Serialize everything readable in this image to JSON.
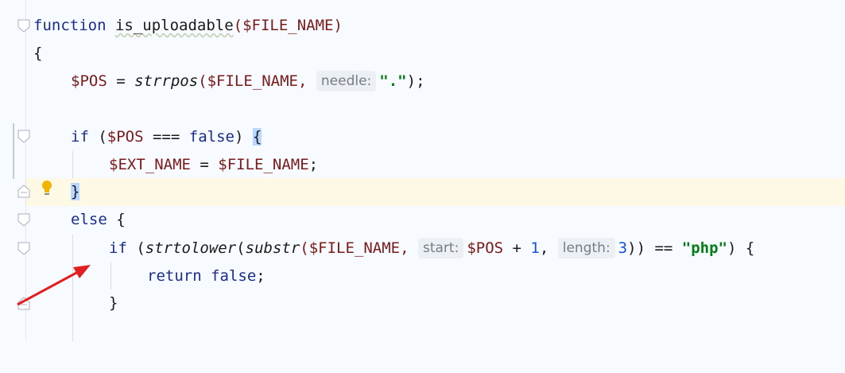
{
  "editor": {
    "lines": [
      {
        "t1": "function ",
        "t2": "is_uploadable",
        "t3": "($FILE_NAME)"
      },
      {
        "t1": "{"
      },
      {
        "t1": "$POS",
        "t2": " = ",
        "t3": "strrpos",
        "t4": "($FILE_NAME, ",
        "hint": "needle:",
        "t5": "\".\"",
        "t6": ");"
      },
      {
        "t1": ""
      },
      {
        "t1": "if",
        "t2": " (",
        "t3": "$POS",
        "t4": " === ",
        "t5": "false",
        "t6": ") ",
        "t7": "{"
      },
      {
        "t1": "$EXT_NAME",
        "t2": " = ",
        "t3": "$FILE_NAME",
        "t4": ";"
      },
      {
        "t1": "}"
      },
      {
        "t1": "else",
        "t2": " {"
      },
      {
        "t1": "if",
        "t2": " (",
        "t3": "strtolower",
        "t4": "(",
        "t5": "substr",
        "t6": "($FILE_NAME, ",
        "hint1": "start:",
        "t7": "$POS",
        "t8": " + ",
        "t9": "1",
        "t10": ", ",
        "hint2": "length:",
        "t11": "3",
        "t12": ")) == ",
        "t13": "\"php\"",
        "t14": ") {"
      },
      {
        "t1": "return",
        "t2": " ",
        "t3": "false",
        "t4": ";"
      },
      {
        "t1": "}"
      }
    ]
  },
  "colors": {
    "background": "#f7faff",
    "keyword": "#1a2d8c",
    "variable": "#7a1a1a",
    "string": "#067d17",
    "number": "#1750eb",
    "arrow": "#e02020"
  },
  "icons": [
    "fold-icon",
    "lightbulb-icon",
    "red-arrow"
  ]
}
